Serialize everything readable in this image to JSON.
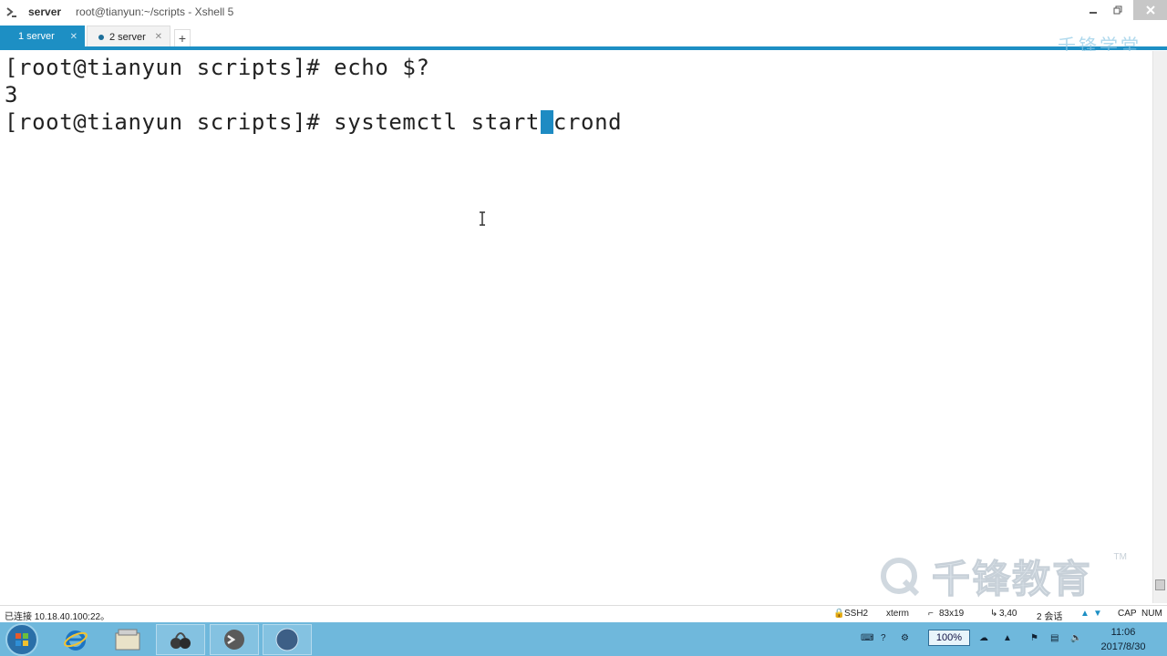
{
  "window": {
    "app_name": "server",
    "title": "root@tianyun:~/scripts - Xshell 5"
  },
  "tabs": [
    {
      "label": "1 server",
      "active": true
    },
    {
      "label": "2 server",
      "active": false
    }
  ],
  "terminal": {
    "lines": [
      "[root@tianyun scripts]# echo $?",
      "3",
      "[root@tianyun scripts]# systemctl start"
    ],
    "after_cursor": "crond",
    "cursor_color": "#1e8bc3"
  },
  "watermark": {
    "top": "千锋学堂",
    "bottom": "千锋教育",
    "tm": "TM"
  },
  "statusbar": {
    "connection": "已连接 10.18.40.100:22。",
    "protocol": "SSH2",
    "term": "xterm",
    "size": "83x19",
    "position": "3,40",
    "sessions": "2 会话",
    "cap": "CAP",
    "num": "NUM"
  },
  "taskbar": {
    "zoom": "100%",
    "time": "11:06",
    "date": "2017/8/30"
  },
  "colors": {
    "accent": "#1d8fc4",
    "taskbar": "#6fb8dc"
  }
}
